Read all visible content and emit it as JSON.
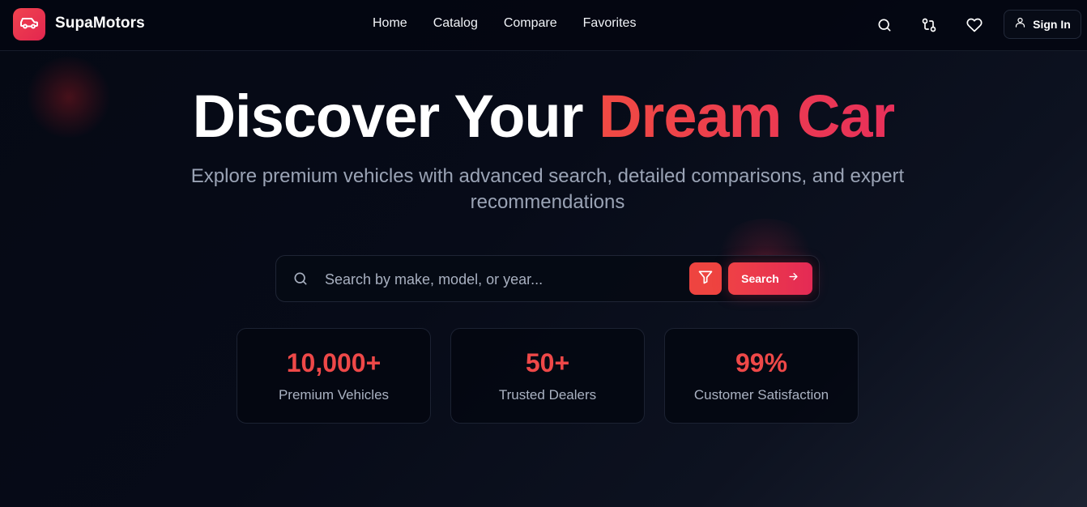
{
  "brand": {
    "name": "SupaMotors",
    "logo_icon": "car-icon"
  },
  "nav": {
    "links": [
      "Home",
      "Catalog",
      "Compare",
      "Favorites"
    ],
    "icons": [
      "search-icon",
      "compare-icon",
      "heart-icon"
    ],
    "sign_in_label": "Sign In"
  },
  "hero": {
    "title_part1": "Discover Your",
    "title_part2": "Dream Car",
    "subtitle": "Explore premium vehicles with advanced search, detailed comparisons, and expert recommendations"
  },
  "search": {
    "placeholder": "Search by make, model, or year...",
    "button_label": "Search"
  },
  "stats": [
    {
      "value": "10,000+",
      "label": "Premium Vehicles"
    },
    {
      "value": "50+",
      "label": "Trusted Dealers"
    },
    {
      "value": "99%",
      "label": "Customer Satisfaction"
    }
  ],
  "colors": {
    "accent": "#ee4848",
    "accent_pink": "#e42a55",
    "background": "#050914",
    "muted_text": "#9aa3b5"
  }
}
